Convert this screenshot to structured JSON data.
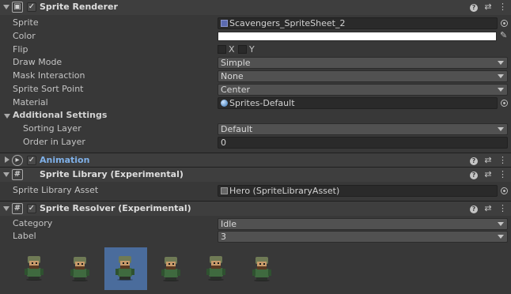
{
  "sprite_renderer": {
    "title": "Sprite Renderer",
    "rows": {
      "sprite_label": "Sprite",
      "sprite_value": "Scavengers_SpriteSheet_2",
      "color_label": "Color",
      "color_value": "#ffffff",
      "flip_label": "Flip",
      "flip_x": "X",
      "flip_y": "Y",
      "draw_mode_label": "Draw Mode",
      "draw_mode_value": "Simple",
      "mask_label": "Mask Interaction",
      "mask_value": "None",
      "sort_point_label": "Sprite Sort Point",
      "sort_point_value": "Center",
      "material_label": "Material",
      "material_value": "Sprites-Default",
      "additional_label": "Additional Settings",
      "sorting_layer_label": "Sorting Layer",
      "sorting_layer_value": "Default",
      "order_label": "Order in Layer",
      "order_value": "0"
    }
  },
  "animation": {
    "title": "Animation"
  },
  "sprite_library": {
    "title": "Sprite Library (Experimental)",
    "asset_label": "Sprite Library Asset",
    "asset_value": "Hero (SpriteLibraryAsset)"
  },
  "sprite_resolver": {
    "title": "Sprite Resolver (Experimental)",
    "category_label": "Category",
    "category_value": "Idle",
    "label_label": "Label",
    "label_value": "3",
    "selected_index": 2,
    "thumbnail_count": 6
  },
  "header_icons": {
    "help": "help-icon",
    "presets": "presets-icon",
    "menu": "kebab-menu-icon"
  },
  "colors": {
    "background": "#383838",
    "header": "#3e3e3e",
    "selection": "#4a6c9c",
    "field": "#2a2a2a",
    "dropdown": "#515151"
  }
}
